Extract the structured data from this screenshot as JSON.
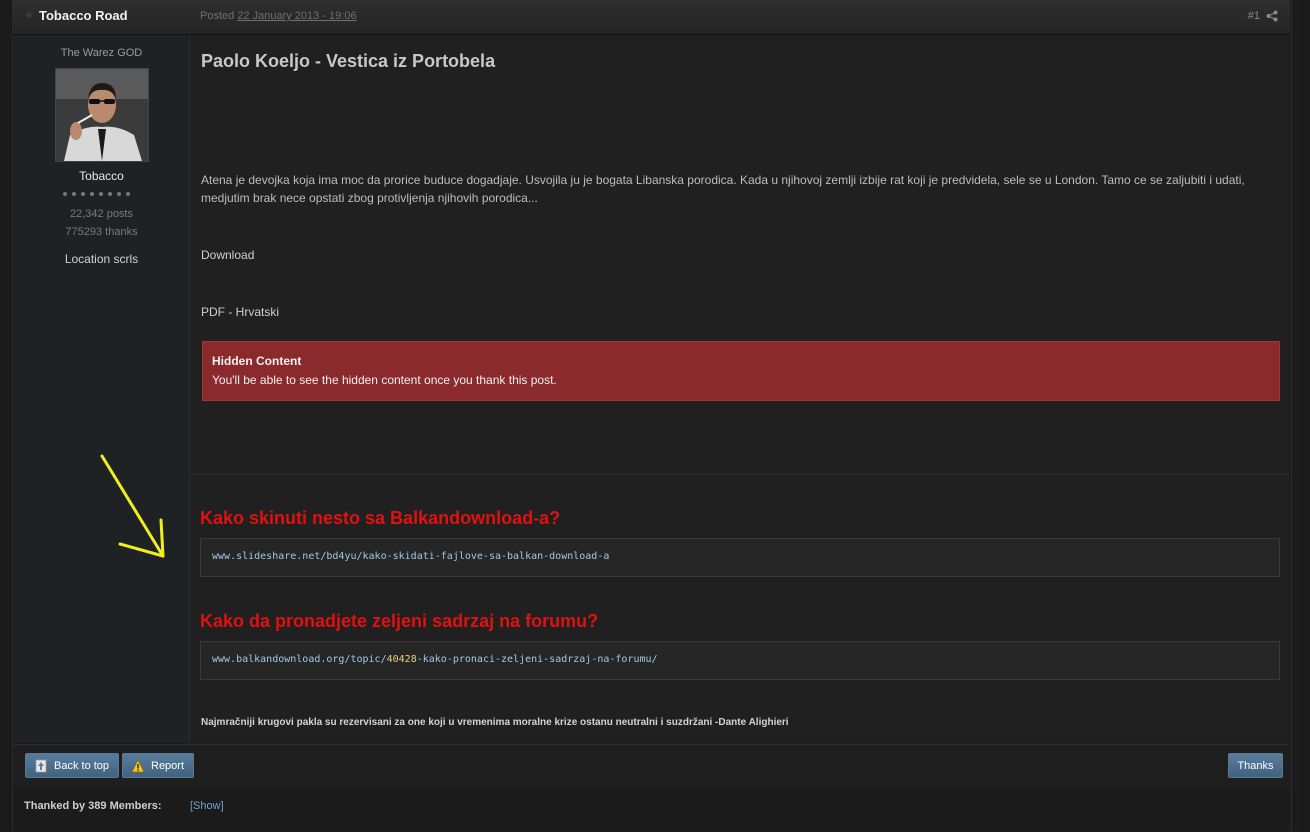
{
  "header": {
    "author": "Tobacco Road",
    "posted_prefix": "Posted",
    "posted_date": "22 January 2013 - 19:06",
    "post_number": "#1"
  },
  "author_panel": {
    "title": "The Warez GOD",
    "username": "Tobacco",
    "posts": "22,342 posts",
    "thanks": "775293 thanks",
    "location": "Location scrls",
    "rank_pips": 8
  },
  "post": {
    "title": "Paolo Koeljo - Vestica iz Portobela",
    "description": "Atena je devojka koja ima moc da prorice buduce dogadjaje. Usvojila ju je bogata Libanska porodica. Kada u njihovoj zemlji izbije rat koji je predvidela, sele se u London. Tamo ce se zaljubiti i udati, medjutim brak nece opstati zbog protivljenja njihovih porodica...",
    "download_label": "Download",
    "format_label": "PDF - Hrvatski",
    "hidden": {
      "title": "Hidden Content",
      "text": "You'll be able to see the hidden content once you thank this post."
    }
  },
  "signature": {
    "heading1": "Kako skinuti nesto sa Balkandownload-a?",
    "code1": "www.slideshare.net/bd4yu/kako-skidati-fajlove-sa-balkan-download-a",
    "heading2": "Kako da pronadjete zeljeni sadrzaj na forumu?",
    "code2_prefix": "www.balkandownload.org/topic/",
    "code2_number": "40428",
    "code2_suffix": "-kako-pronaci-zeljeni-sadrzaj-na-forumu/",
    "quote": "Najmračniji krugovi pakla su rezervisani za one koji u vremenima moralne krize ostanu neutralni i suzdržani -Dante Alighieri"
  },
  "buttons": {
    "back_to_top": "Back to top",
    "report": "Report",
    "thanks": "Thanks"
  },
  "thanked": {
    "label": "Thanked by 389 Members:",
    "show": "[Show]"
  },
  "colors": {
    "signature_heading": "#e01111",
    "hidden_box": "#8b2a2c",
    "button": "#4a6d8c",
    "arrow": "#f2ee1c"
  }
}
